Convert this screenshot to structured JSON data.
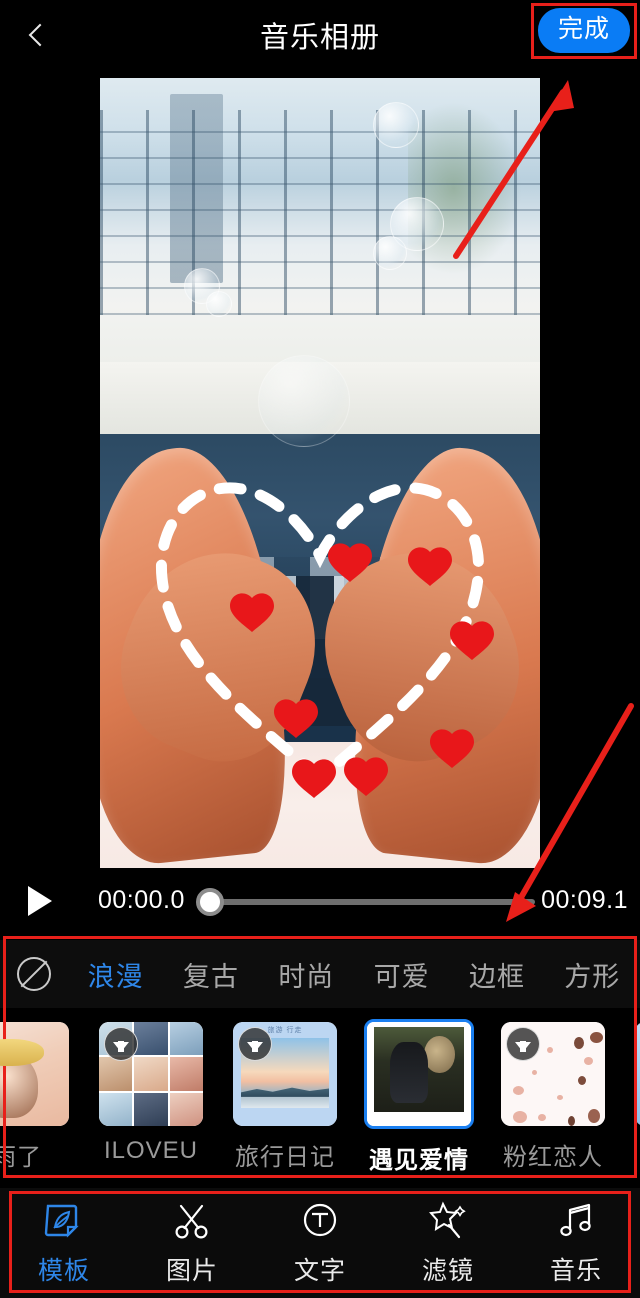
{
  "header": {
    "back_icon": "chevron-left-icon",
    "title": "音乐相册",
    "done_label": "完成"
  },
  "player": {
    "play_icon": "play-icon",
    "current_time": "00:00.0",
    "total_time": "00:09.1",
    "progress_percent": 0
  },
  "categories": {
    "none_icon": "no-template-icon",
    "items": [
      {
        "label": "浪漫",
        "active": true
      },
      {
        "label": "复古",
        "active": false
      },
      {
        "label": "时尚",
        "active": false
      },
      {
        "label": "可爱",
        "active": false
      },
      {
        "label": "边框",
        "active": false
      },
      {
        "label": "方形",
        "active": false
      }
    ]
  },
  "templates": [
    {
      "label": "雨了",
      "selected": false,
      "downloadable": false,
      "art": "girl"
    },
    {
      "label": "ILOVEU",
      "selected": false,
      "downloadable": true,
      "art": "grid"
    },
    {
      "label": "旅行日记",
      "selected": false,
      "downloadable": true,
      "art": "travel",
      "inner_text": "旅游 行走"
    },
    {
      "label": "遇见爱情",
      "selected": true,
      "downloadable": false,
      "art": "couple"
    },
    {
      "label": "粉红恋人",
      "selected": false,
      "downloadable": true,
      "art": "pink"
    },
    {
      "label": "",
      "selected": false,
      "downloadable": true,
      "art": "blue"
    }
  ],
  "bottom_nav": [
    {
      "label": "模板",
      "icon": "template-icon",
      "active": true
    },
    {
      "label": "图片",
      "icon": "scissors-icon",
      "active": false
    },
    {
      "label": "文字",
      "icon": "text-circle-icon",
      "active": false
    },
    {
      "label": "滤镜",
      "icon": "magic-wand-icon",
      "active": false
    },
    {
      "label": "音乐",
      "icon": "music-note-icon",
      "active": false
    }
  ],
  "annotations": {
    "color": "#e8201a",
    "boxes": [
      "done-button",
      "template-panel",
      "bottom-nav"
    ],
    "arrows": [
      "arrow-to-done-button",
      "arrow-to-template-panel"
    ]
  },
  "theme": {
    "accent_blue": "#0a7cf5",
    "tab_active_blue": "#2e86e8",
    "annotation_red": "#e8201a",
    "background": "#000000"
  }
}
